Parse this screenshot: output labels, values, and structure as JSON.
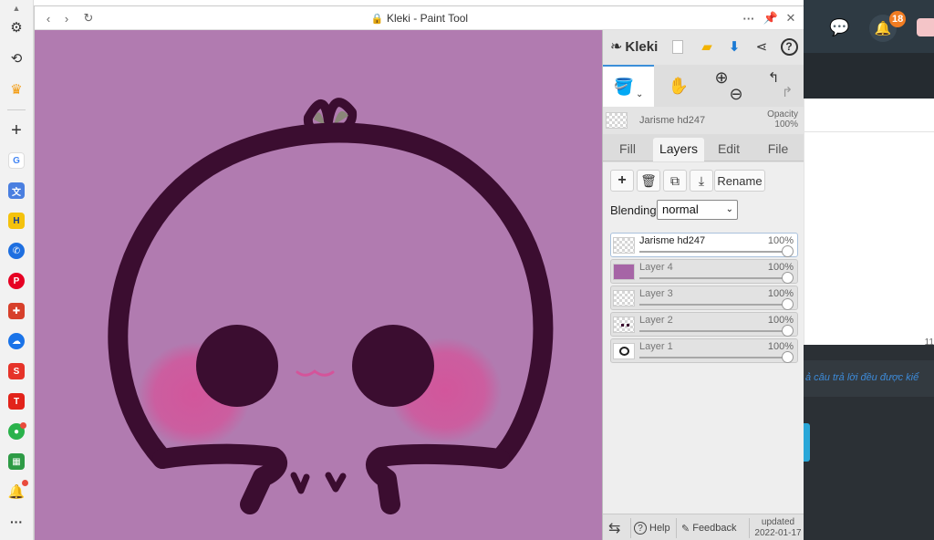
{
  "window": {
    "title": "Kleki - Paint Tool",
    "more_icon": "more-dots-icon",
    "pin_icon": "pin-icon",
    "close_icon": "close-icon"
  },
  "app": {
    "logo_text": "Kleki",
    "layer_name": "Jarisme hd247",
    "opacity_label": "Opacity",
    "opacity_value": "100%",
    "tabs": [
      {
        "label": "Fill"
      },
      {
        "label": "Layers"
      },
      {
        "label": "Edit"
      },
      {
        "label": "File"
      }
    ],
    "active_tab": "Layers",
    "rename_label": "Rename",
    "blending_label": "Blending",
    "blending_value": "normal",
    "layers": [
      {
        "name": "Jarisme hd247",
        "opacity": "100%"
      },
      {
        "name": "Layer 4",
        "opacity": "100%"
      },
      {
        "name": "Layer 3",
        "opacity": "100%"
      },
      {
        "name": "Layer 2",
        "opacity": "100%"
      },
      {
        "name": "Layer 1",
        "opacity": "100%"
      }
    ],
    "footer": {
      "help": "Help",
      "feedback": "Feedback",
      "updated_label": "updated",
      "updated_date": "2022-01-17"
    }
  },
  "colors": {
    "canvas_bg": "#b17bb0",
    "outline": "#3b0d30",
    "blush": "#d4549a",
    "accent_blue": "#1a7ad4"
  },
  "background_page": {
    "notification_count": "18",
    "partial_number": "11",
    "partial_text": "ả câu trả lời đều được kiể"
  }
}
